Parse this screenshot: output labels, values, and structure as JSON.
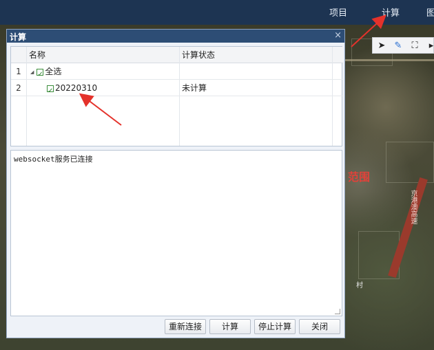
{
  "topnav": {
    "items": [
      {
        "label": "项目"
      },
      {
        "label": "计算"
      },
      {
        "label": "图"
      }
    ]
  },
  "map": {
    "label_range": "范围",
    "label_village": "村",
    "label_road": "京港澳高速"
  },
  "dialog": {
    "title": "计算",
    "close": "×",
    "grid": {
      "columns": [
        "名称",
        "计算状态"
      ],
      "rows": [
        {
          "index": "1",
          "name": "全选",
          "status": ""
        },
        {
          "index": "2",
          "name": "20220310",
          "status": "未计算"
        }
      ]
    },
    "log_text": "websocket服务已连接",
    "buttons": {
      "reconnect": "重新连接",
      "calculate": "计算",
      "stop": "停止计算",
      "close": "关闭"
    }
  },
  "colors": {
    "header_bg": "#1d3452",
    "dialog_header": "#2d4d75",
    "arrow": "#e4322b"
  }
}
